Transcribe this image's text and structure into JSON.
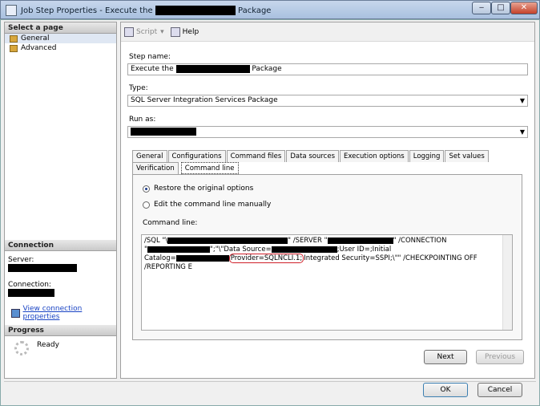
{
  "window": {
    "title_prefix": "Job Step Properties - Execute the",
    "title_suffix": "Package",
    "min": "‒",
    "max": "□",
    "close": "✕"
  },
  "left": {
    "select_page": "Select a page",
    "pages": [
      "General",
      "Advanced"
    ],
    "connection_head": "Connection",
    "server_label": "Server:",
    "connection_label": "Connection:",
    "view_conn": "View connection properties",
    "progress_head": "Progress",
    "ready": "Ready"
  },
  "toolbar": {
    "script": "Script",
    "help": "Help"
  },
  "form": {
    "step_name_label": "Step name:",
    "step_name_prefix": "Execute the",
    "step_name_suffix": "Package",
    "type_label": "Type:",
    "type_value": "SQL Server Integration Services Package",
    "run_as_label": "Run as:"
  },
  "tabs": [
    "General",
    "Configurations",
    "Command files",
    "Data sources",
    "Execution options",
    "Logging",
    "Set values",
    "Verification",
    "Command line"
  ],
  "cmd": {
    "restore": "Restore the original options",
    "edit": "Edit the command line manually",
    "label": "Command line:",
    "line1a": "/SQL \"\\",
    "line1b": "\" /SERVER \"",
    "line1c": "\" /CONNECTION",
    "line2a": "\"",
    "line2b": "\";\"\\\"Data Source=",
    "line2c": ";User ID=;Initial",
    "line3a": "Catalog=",
    "line3hl": "Provider=SQLNCLI.1;",
    "line3b": "Integrated Security=SSPI;\\\"\" /CHECKPOINTING OFF",
    "line4": "/REPORTING E"
  },
  "buttons": {
    "next": "Next",
    "previous": "Previous",
    "ok": "OK",
    "cancel": "Cancel"
  }
}
